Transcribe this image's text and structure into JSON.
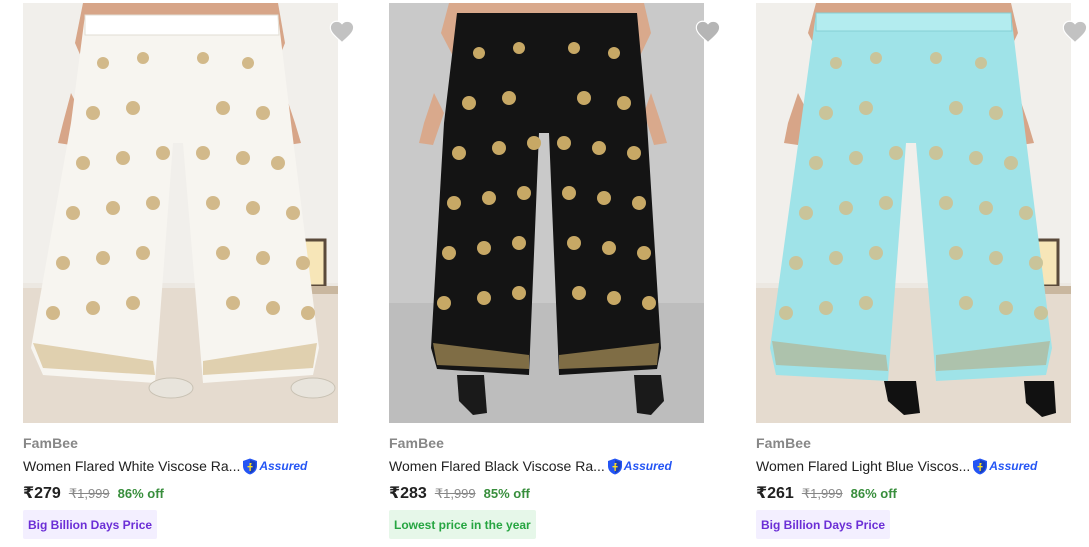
{
  "products": [
    {
      "brand": "FamBee",
      "title": "Women Flared White Viscose Ra...",
      "assured_label": "Assured",
      "price": "₹279",
      "mrp": "₹1,999",
      "discount": "86% off",
      "badge": "Big Billion Days Price",
      "badge_style": "purple",
      "image": "white-palazzo-image",
      "pant_color": "#f7f5f0",
      "motif_color": "#d2b98a"
    },
    {
      "brand": "FamBee",
      "title": "Women Flared Black Viscose Ra...",
      "assured_label": "Assured",
      "price": "₹283",
      "mrp": "₹1,999",
      "discount": "85% off",
      "badge": "Lowest price in the year",
      "badge_style": "green",
      "image": "black-palazzo-image",
      "pant_color": "#141414",
      "motif_color": "#c7a865"
    },
    {
      "brand": "FamBee",
      "title": "Women Flared Light Blue Viscos...",
      "assured_label": "Assured",
      "price": "₹261",
      "mrp": "₹1,999",
      "discount": "86% off",
      "badge": "Big Billion Days Price",
      "badge_style": "purple",
      "image": "light-blue-palazzo-image",
      "pant_color": "#9fe3e8",
      "motif_color": "#c9c49a"
    }
  ],
  "colors": {
    "price_text": "#212121",
    "muted": "#878787",
    "discount": "#388e3c",
    "assured_blue": "#2455f4"
  }
}
